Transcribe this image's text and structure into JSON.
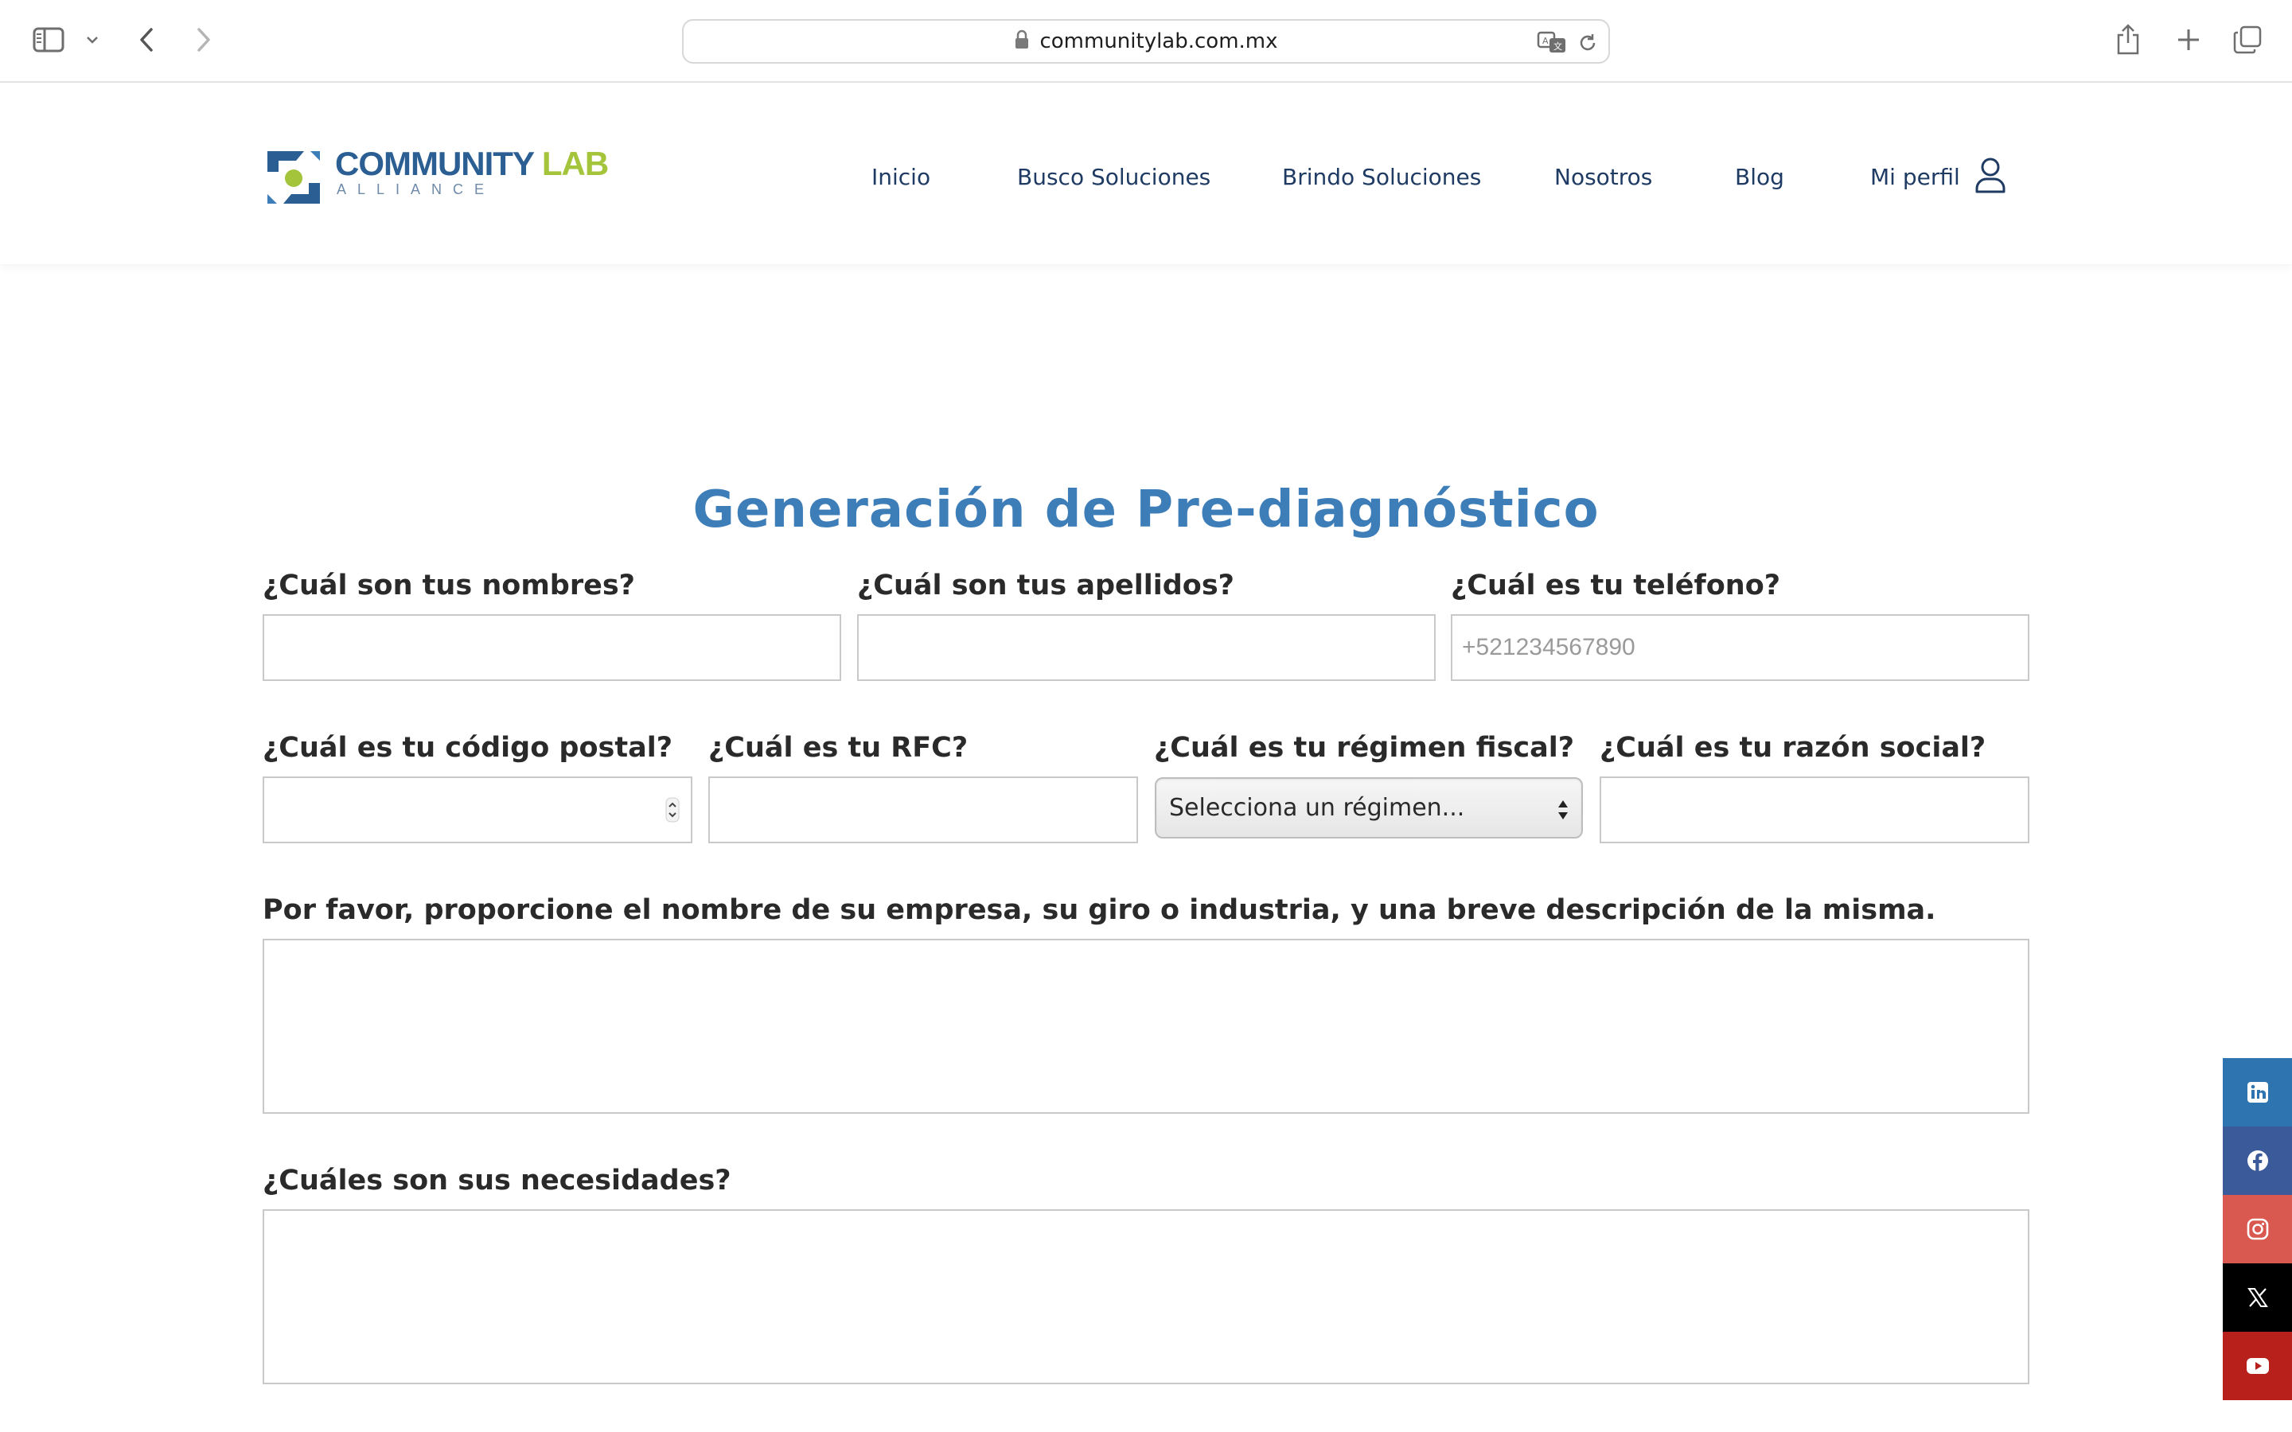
{
  "browser": {
    "url": "communitylab.com.mx",
    "icons": [
      "sidebar-icon",
      "chevron-down-icon",
      "back-icon",
      "forward-icon",
      "lock-icon",
      "translate-icon",
      "reload-icon",
      "share-icon",
      "new-tab-icon",
      "tabs-overview-icon"
    ]
  },
  "header": {
    "logo": {
      "word1": "COMMUNITY",
      "word2": "LAB",
      "sub": "ALLIANCE",
      "colors": {
        "blue": "#2b5f94",
        "green": "#a4c43c"
      }
    },
    "nav": [
      {
        "label": "Inicio"
      },
      {
        "label": "Busco Soluciones"
      },
      {
        "label": "Brindo Soluciones"
      },
      {
        "label": "Nosotros"
      },
      {
        "label": "Blog"
      },
      {
        "label": "Mi perfil"
      }
    ]
  },
  "form": {
    "title": "Generación de Pre-diagnóstico",
    "fields": {
      "nombres": {
        "label": "¿Cuál son tus nombres?",
        "value": "",
        "placeholder": ""
      },
      "apellidos": {
        "label": "¿Cuál son tus apellidos?",
        "value": "",
        "placeholder": ""
      },
      "telefono": {
        "label": "¿Cuál es tu teléfono?",
        "value": "",
        "placeholder": "+521234567890"
      },
      "codigo_postal": {
        "label": "¿Cuál es tu código postal?",
        "value": ""
      },
      "rfc": {
        "label": "¿Cuál es tu RFC?",
        "value": ""
      },
      "regimen": {
        "label": "¿Cuál es tu régimen fiscal?",
        "selected": "Selecciona un régimen..."
      },
      "razon_social": {
        "label": "¿Cuál es tu razón social?",
        "value": ""
      },
      "empresa": {
        "label": "Por favor, proporcione el nombre de su empresa, su giro o industria, y una breve descripción de la misma.",
        "value": ""
      },
      "necesidades": {
        "label": "¿Cuáles son sus necesidades?",
        "value": ""
      }
    },
    "title_color": "#3d7db8"
  },
  "social": [
    {
      "name": "linkedin-icon",
      "color": "#2d74b0"
    },
    {
      "name": "facebook-icon",
      "color": "#3b5a99"
    },
    {
      "name": "instagram-icon",
      "color": "#d9584f"
    },
    {
      "name": "x-icon",
      "color": "#000000"
    },
    {
      "name": "youtube-icon",
      "color": "#b8201c"
    }
  ]
}
